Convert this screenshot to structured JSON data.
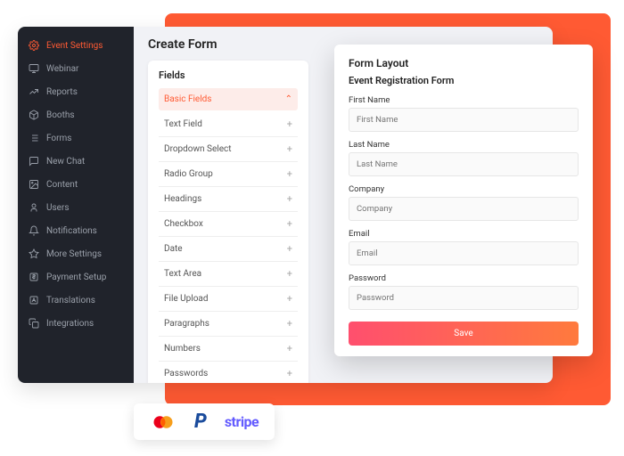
{
  "sidebar": {
    "items": [
      {
        "label": "Event Settings",
        "icon": "gear"
      },
      {
        "label": "Webinar",
        "icon": "monitor"
      },
      {
        "label": "Reports",
        "icon": "chart"
      },
      {
        "label": "Booths",
        "icon": "cube"
      },
      {
        "label": "Forms",
        "icon": "list"
      },
      {
        "label": "New Chat",
        "icon": "chat"
      },
      {
        "label": "Content",
        "icon": "image"
      },
      {
        "label": "Users",
        "icon": "user"
      },
      {
        "label": "Notifications",
        "icon": "bell"
      },
      {
        "label": "More Settings",
        "icon": "gear-outline"
      },
      {
        "label": "Payment Setup",
        "icon": "dollar"
      },
      {
        "label": "Translations",
        "icon": "lang"
      },
      {
        "label": "Integrations",
        "icon": "copy"
      }
    ]
  },
  "page_title": "Create Form",
  "fields": {
    "heading": "Fields",
    "group_label": "Basic Fields",
    "items": [
      "Text Field",
      "Dropdown Select",
      "Radio Group",
      "Headings",
      "Checkbox",
      "Date",
      "Text Area",
      "File Upload",
      "Paragraphs",
      "Numbers",
      "Passwords"
    ]
  },
  "form_layout": {
    "heading": "Form Layout",
    "title": "Event Registration Form",
    "fields": [
      {
        "label": "First Name",
        "placeholder": "First Name"
      },
      {
        "label": "Last Name",
        "placeholder": "Last Name"
      },
      {
        "label": "Company",
        "placeholder": "Company"
      },
      {
        "label": "Email",
        "placeholder": "Email"
      },
      {
        "label": "Password",
        "placeholder": "Password"
      }
    ],
    "save_label": "Save"
  },
  "payments": [
    "mastercard",
    "paypal",
    "stripe"
  ]
}
